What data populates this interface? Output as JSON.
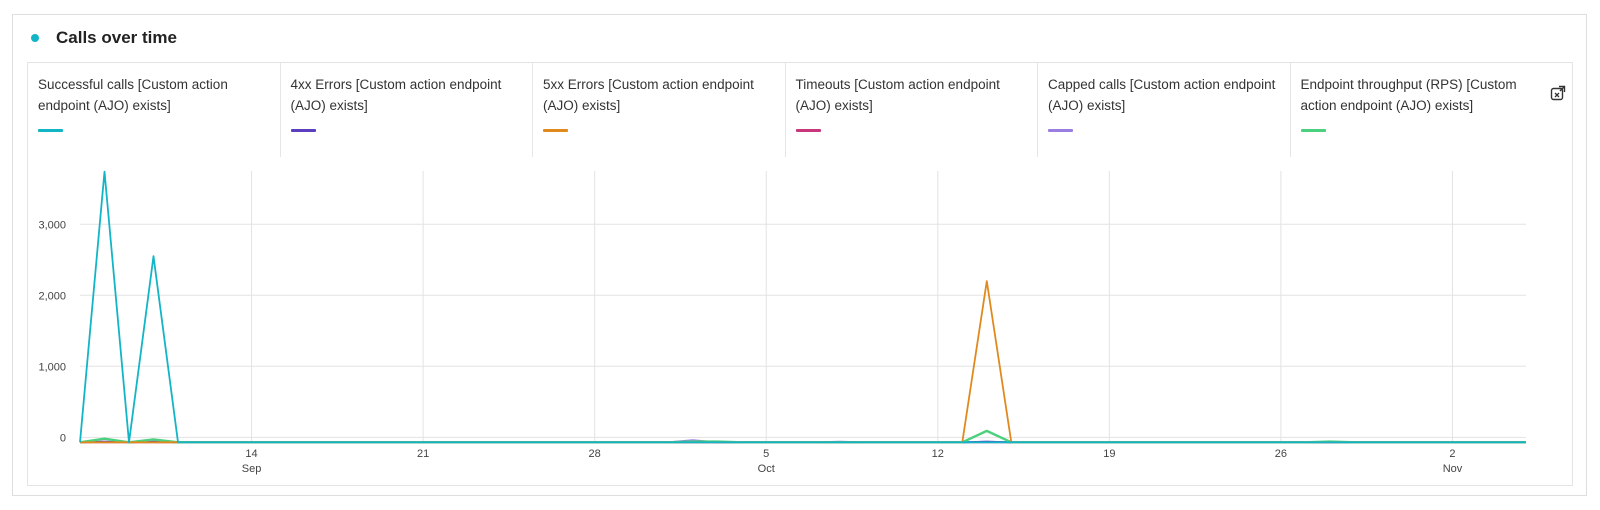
{
  "header": {
    "title": "Calls over time",
    "dot_color": "#12b5c6"
  },
  "toolbar": {
    "export_icon": "export-icon"
  },
  "chart_data": {
    "type": "line",
    "title": "Calls over time",
    "x_dates": [
      "Sep 7",
      "Sep 8",
      "Sep 9",
      "Sep 10",
      "Sep 11",
      "Sep 12",
      "Sep 13",
      "Sep 14",
      "Sep 15",
      "Sep 16",
      "Sep 17",
      "Sep 18",
      "Sep 19",
      "Sep 20",
      "Sep 21",
      "Sep 22",
      "Sep 23",
      "Sep 24",
      "Sep 25",
      "Sep 26",
      "Sep 27",
      "Sep 28",
      "Sep 29",
      "Sep 30",
      "Oct 1",
      "Oct 2",
      "Oct 3",
      "Oct 4",
      "Oct 5",
      "Oct 6",
      "Oct 7",
      "Oct 8",
      "Oct 9",
      "Oct 10",
      "Oct 11",
      "Oct 12",
      "Oct 13",
      "Oct 14",
      "Oct 15",
      "Oct 16",
      "Oct 17",
      "Oct 18",
      "Oct 19",
      "Oct 20",
      "Oct 21",
      "Oct 22",
      "Oct 23",
      "Oct 24",
      "Oct 25",
      "Oct 26",
      "Oct 27",
      "Oct 28",
      "Oct 29",
      "Oct 30",
      "Oct 31",
      "Nov 1",
      "Nov 2",
      "Nov 3",
      "Nov 4",
      "Nov 5"
    ],
    "xticks": [
      {
        "date": "Sep 14",
        "label": "14",
        "sublabel": "Sep"
      },
      {
        "date": "Sep 21",
        "label": "21",
        "sublabel": ""
      },
      {
        "date": "Sep 28",
        "label": "28",
        "sublabel": ""
      },
      {
        "date": "Oct 5",
        "label": "5",
        "sublabel": "Oct"
      },
      {
        "date": "Oct 12",
        "label": "12",
        "sublabel": ""
      },
      {
        "date": "Oct 19",
        "label": "19",
        "sublabel": ""
      },
      {
        "date": "Oct 26",
        "label": "26",
        "sublabel": ""
      },
      {
        "date": "Nov 2",
        "label": "2",
        "sublabel": "Nov"
      }
    ],
    "yticks": [
      {
        "value": 0,
        "label": "0"
      },
      {
        "value": 1000,
        "label": "1,000"
      },
      {
        "value": 2000,
        "label": "2,000"
      },
      {
        "value": 3000,
        "label": "3,000"
      }
    ],
    "ylim": [
      -80,
      3750
    ],
    "grid": true,
    "legend_position": "top",
    "series": [
      {
        "name": "Successful calls [Custom action endpoint (AJO) exists]",
        "color": "#12b5c6",
        "values": [
          -70,
          3740,
          -70,
          2550,
          -70,
          -70,
          -70,
          -70,
          -70,
          -70,
          -70,
          -70,
          -70,
          -70,
          -70,
          -70,
          -70,
          -70,
          -70,
          -70,
          -70,
          -70,
          -70,
          -70,
          -70,
          -70,
          -70,
          -70,
          -70,
          -70,
          -70,
          -70,
          -70,
          -70,
          -70,
          -70,
          -70,
          -70,
          -70,
          -70,
          -70,
          -70,
          -70,
          -70,
          -70,
          -70,
          -70,
          -70,
          -70,
          -70,
          -70,
          -70,
          -70,
          -70,
          -70,
          -70,
          -70,
          -70,
          -70,
          -70
        ]
      },
      {
        "name": "4xx Errors [Custom action endpoint (AJO) exists]",
        "color": "#5b3fbf",
        "values": [
          -70,
          -60,
          -70,
          -60,
          -70,
          -70,
          -70,
          -70,
          -70,
          -70,
          -70,
          -70,
          -70,
          -70,
          -70,
          -70,
          -70,
          -70,
          -70,
          -70,
          -70,
          -70,
          -70,
          -70,
          -70,
          -70,
          -70,
          -70,
          -70,
          -70,
          -70,
          -70,
          -70,
          -70,
          -70,
          -70,
          -70,
          -60,
          -70,
          -70,
          -70,
          -70,
          -70,
          -70,
          -70,
          -70,
          -70,
          -70,
          -70,
          -70,
          -70,
          -70,
          -70,
          -70,
          -70,
          -70,
          -70,
          -70,
          -70,
          -70
        ]
      },
      {
        "name": "5xx Errors [Custom action endpoint (AJO) exists]",
        "color": "#e08a1e",
        "values": [
          -70,
          -70,
          -70,
          -70,
          -70,
          -70,
          -70,
          -70,
          -70,
          -70,
          -70,
          -70,
          -70,
          -70,
          -70,
          -70,
          -70,
          -70,
          -70,
          -70,
          -70,
          -70,
          -70,
          -70,
          -70,
          -70,
          -70,
          -70,
          -70,
          -70,
          -70,
          -70,
          -70,
          -70,
          -70,
          -70,
          -70,
          2200,
          -70,
          -70,
          -70,
          -70,
          -70,
          -70,
          -70,
          -70,
          -70,
          -70,
          -70,
          -70,
          -70,
          -70,
          -70,
          -70,
          -70,
          -70,
          -70,
          -70,
          -70,
          -70
        ]
      },
      {
        "name": "Timeouts [Custom action endpoint (AJO) exists]",
        "color": "#c8367c",
        "values": [
          -70,
          -70,
          -70,
          -70,
          -70,
          -70,
          -70,
          -70,
          -70,
          -70,
          -70,
          -70,
          -70,
          -70,
          -70,
          -70,
          -70,
          -70,
          -70,
          -70,
          -70,
          -70,
          -70,
          -70,
          -70,
          -70,
          -70,
          -70,
          -70,
          -70,
          -70,
          -70,
          -70,
          -70,
          -70,
          -70,
          -70,
          -70,
          -70,
          -70,
          -70,
          -70,
          -70,
          -70,
          -70,
          -70,
          -70,
          -70,
          -70,
          -70,
          -70,
          -70,
          -70,
          -70,
          -70,
          -70,
          -70,
          -70,
          -70,
          -70
        ]
      },
      {
        "name": "Capped calls [Custom action endpoint (AJO) exists]",
        "color": "#9b7fe0",
        "values": [
          -70,
          -60,
          -70,
          -60,
          -70,
          -70,
          -70,
          -70,
          -70,
          -70,
          -70,
          -70,
          -70,
          -70,
          -70,
          -70,
          -70,
          -70,
          -70,
          -70,
          -70,
          -70,
          -70,
          -70,
          -70,
          -40,
          -70,
          -70,
          -70,
          -70,
          -70,
          -60,
          -70,
          -70,
          -70,
          -70,
          -70,
          -60,
          -70,
          -70,
          -70,
          -70,
          -70,
          -70,
          -70,
          -70,
          -70,
          -70,
          -70,
          -70,
          -70,
          -70,
          -70,
          -70,
          -70,
          -70,
          -70,
          -70,
          -70,
          -70
        ]
      },
      {
        "name": "Endpoint throughput (RPS) [Custom action endpoint (AJO) exists]",
        "color": "#4bd07e",
        "values": [
          -70,
          -20,
          -70,
          -30,
          -70,
          -70,
          -70,
          -70,
          -70,
          -70,
          -70,
          -70,
          -70,
          -70,
          -70,
          -70,
          -70,
          -70,
          -70,
          -70,
          -70,
          -70,
          -70,
          -70,
          -70,
          -60,
          -60,
          -70,
          -70,
          -70,
          -70,
          -70,
          -70,
          -70,
          -70,
          -70,
          -70,
          90,
          -70,
          -70,
          -70,
          -70,
          -70,
          -70,
          -70,
          -70,
          -70,
          -70,
          -70,
          -70,
          -70,
          -60,
          -70,
          -70,
          -70,
          -70,
          -70,
          -70,
          -70,
          -70
        ]
      }
    ]
  }
}
